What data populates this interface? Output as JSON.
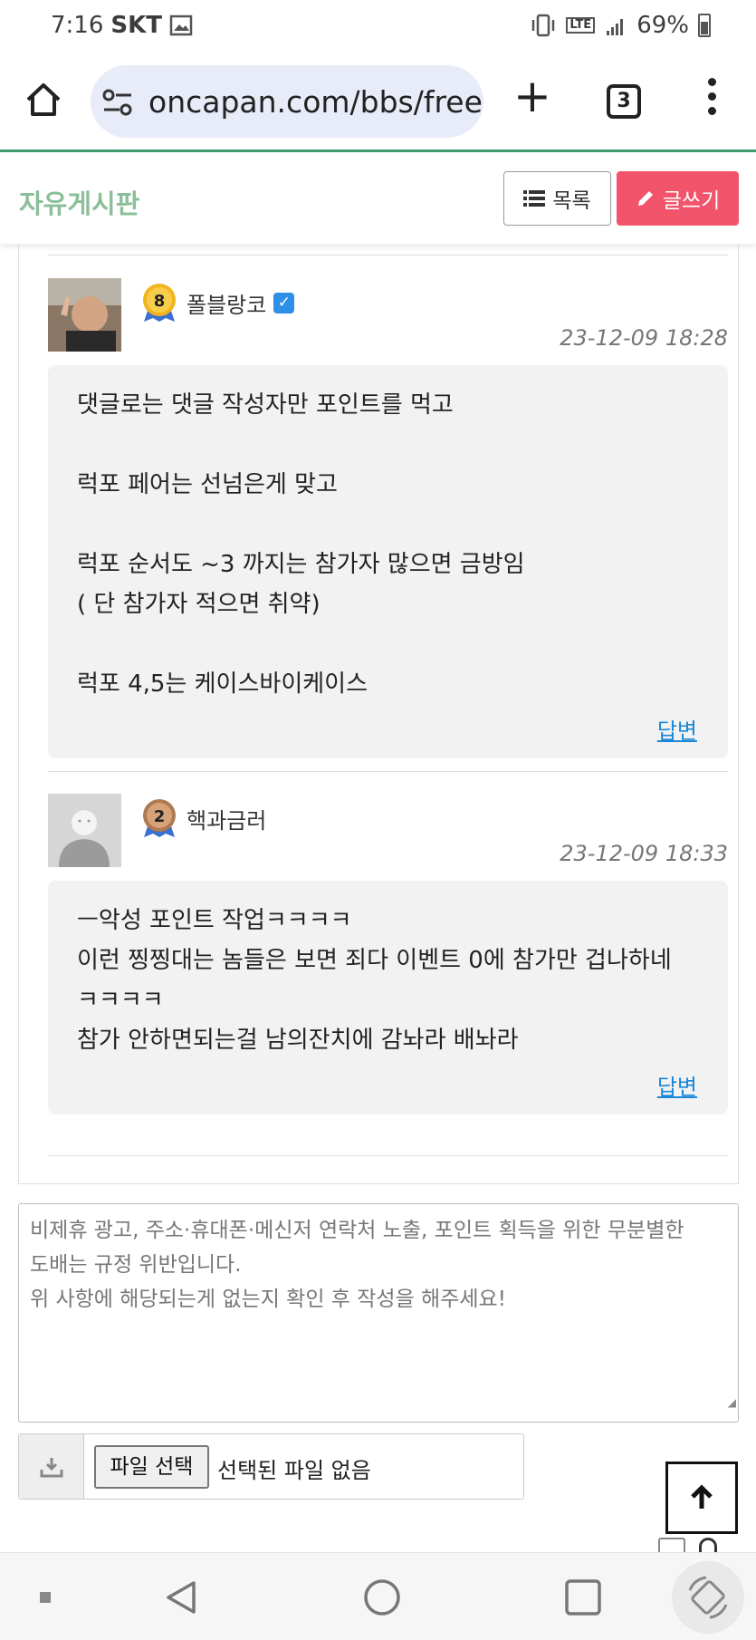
{
  "status_bar": {
    "time": "7:16",
    "carrier": "SKT",
    "network": "LTE",
    "battery": "69%"
  },
  "browser": {
    "url": "oncapan.com/bbs/free",
    "tab_count": "3"
  },
  "board": {
    "title": "자유게시판",
    "list_button": "목록",
    "write_button": "글쓰기"
  },
  "comments": [
    {
      "author": "폴블랑코",
      "level": "8",
      "verified": true,
      "date": "23-12-09 18:28",
      "lines": [
        "댓글로는 댓글 작성자만 포인트를 먹고",
        "",
        "럭포 페어는 선넘은게 맞고",
        "",
        "럭포 순서도 ~3 까지는 참가자 많으면 금방임",
        "( 단 참가자 적으면 취약)",
        "",
        "럭포 4,5는 케이스바이케이스"
      ],
      "reply_label": "답변"
    },
    {
      "author": "핵과금러",
      "level": "2",
      "verified": false,
      "date": "23-12-09 18:33",
      "lines": [
        "ㅡ악성 포인트 작업ㅋㅋㅋㅋ",
        "이런 찡찡대는 놈들은 보면 죄다 이벤트 0에 참가만 겁나하네",
        "ㅋㅋㅋㅋ",
        "참가 안하면되는걸 남의잔치에 감놔라 배놔라"
      ],
      "reply_label": "답변"
    }
  ],
  "comment_form": {
    "placeholder_lines": [
      "비제휴 광고, 주소·휴대폰·메신저 연락처 노출, 포인트 획득을 위한 무분별한",
      "도배는 규정 위반입니다.",
      "위 사항에 해당되는게 없는지 확인 후 작성을 해주세요!"
    ],
    "file_button": "파일 선택",
    "file_status": "선택된 파일 없음"
  },
  "colors": {
    "board_title": "#8bbf9a",
    "write_button": "#f2546c",
    "reply_link": "#1a88d8",
    "browser_accent": "#3a9a6a"
  },
  "icons": [
    "home-icon",
    "site-settings-icon",
    "plus-icon",
    "tabs-icon",
    "more-vert-icon",
    "list-icon",
    "pencil-icon",
    "verified-icon",
    "download-icon",
    "arrow-up-icon"
  ]
}
